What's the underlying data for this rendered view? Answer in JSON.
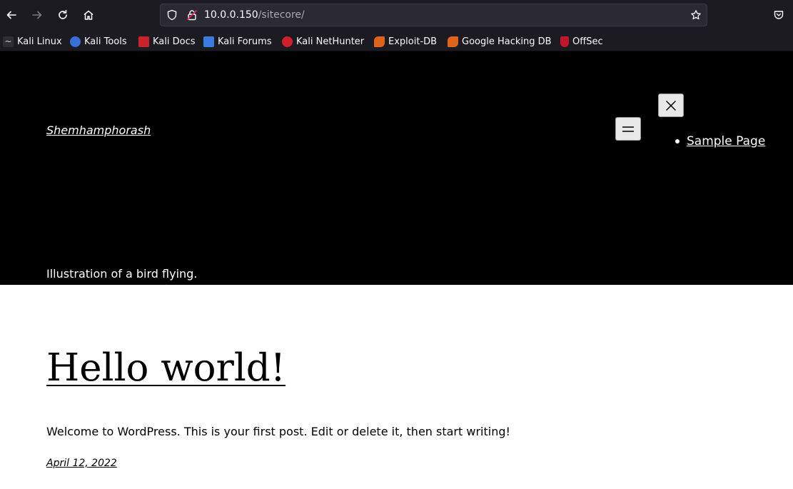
{
  "browser": {
    "url_host": "10.0.0.150",
    "url_path": "/sitecore/",
    "icons": [
      "back-arrow-icon",
      "forward-arrow-icon",
      "reload-icon",
      "home-icon",
      "shield-icon",
      "insecure-lock-icon",
      "bookmark-star-icon",
      "pocket-icon"
    ],
    "bookmarks": [
      {
        "label": "Kali Linux",
        "icon": "kali-dragon-icon"
      },
      {
        "label": "Kali Tools",
        "icon": "kali-tools-icon"
      },
      {
        "label": "Kali Docs",
        "icon": "kali-docs-icon"
      },
      {
        "label": "Kali Forums",
        "icon": "kali-forums-icon"
      },
      {
        "label": "Kali NetHunter",
        "icon": "kali-nethunter-icon"
      },
      {
        "label": "Exploit-DB",
        "icon": "exploit-db-icon"
      },
      {
        "label": "Google Hacking DB",
        "icon": "ghdb-icon"
      },
      {
        "label": "OffSec",
        "icon": "offsec-icon"
      }
    ]
  },
  "header": {
    "site_title": "Shemhamphorash",
    "nav_items": [
      "Sample Page"
    ],
    "image_alt": "Illustration of a bird flying."
  },
  "post": {
    "title": "Hello world!",
    "content": "Welcome to WordPress. This is your first post. Edit or delete it, then start writing!",
    "date": "April 12, 2022"
  },
  "colors": {
    "chrome_bg": "#1c1b22",
    "urlbar_bg": "#2b2a33",
    "header_bg": "#000000",
    "page_bg": "#ffffff"
  }
}
